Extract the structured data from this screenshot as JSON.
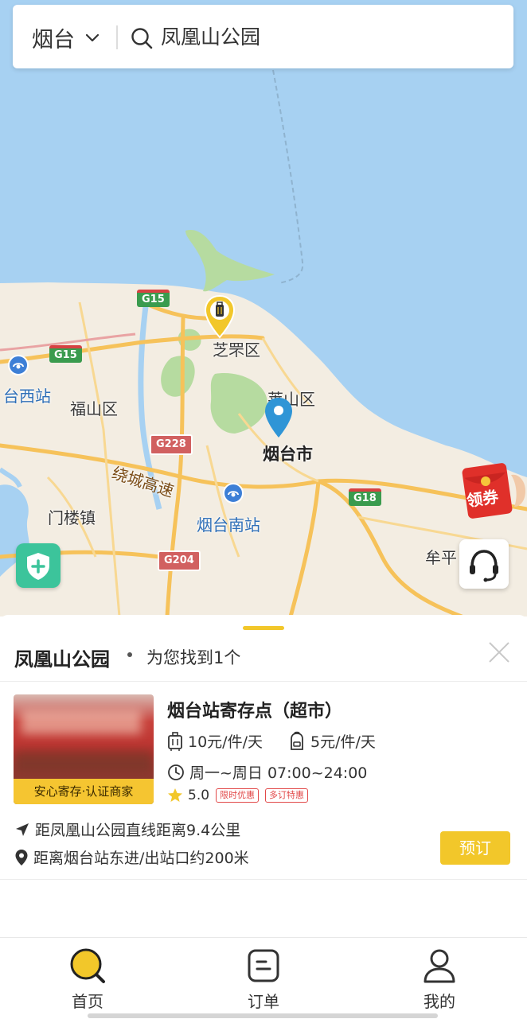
{
  "search": {
    "city": "烟台",
    "query": "凤凰山公园"
  },
  "map": {
    "labels": {
      "zhifu": "芝罘区",
      "laishan": "莱山区",
      "fushan": "福山区",
      "yantai_city": "烟台市",
      "menlou": "门楼镇",
      "yantai_south": "烟台南站",
      "west_station": "台西站",
      "muping": "牟平",
      "expressway": "绕城高速"
    },
    "shields": {
      "g15_a": "G15",
      "g15_b": "G15",
      "g228": "G228",
      "g18": "G18",
      "g204": "G204"
    },
    "coupon_label": "领券",
    "colors": {
      "sea": "#a7d1f2",
      "land": "#f3ede2",
      "park": "#b6dba0",
      "road": "#f6c25a",
      "accent": "#f2c72a"
    }
  },
  "panel": {
    "title": "凤凰山公园",
    "result_count": "为您找到1个",
    "store": {
      "name": "烟台站寄存点（超市）",
      "badge": "安心寄存·认证商家",
      "price_luggage": "10元/件/天",
      "price_backpack": "5元/件/天",
      "hours": "周一~周日 07:00~24:00",
      "rating": "5.0",
      "tags": [
        "限时优惠",
        "多订特惠"
      ],
      "distance_line": "距凤凰山公园直线距离9.4公里",
      "location_line": "距离烟台站东进/出站口约200米",
      "book_label": "预订"
    }
  },
  "tabbar": {
    "items": [
      {
        "label": "首页",
        "icon": "home-search-icon"
      },
      {
        "label": "订单",
        "icon": "order-icon"
      },
      {
        "label": "我的",
        "icon": "profile-icon"
      }
    ]
  }
}
